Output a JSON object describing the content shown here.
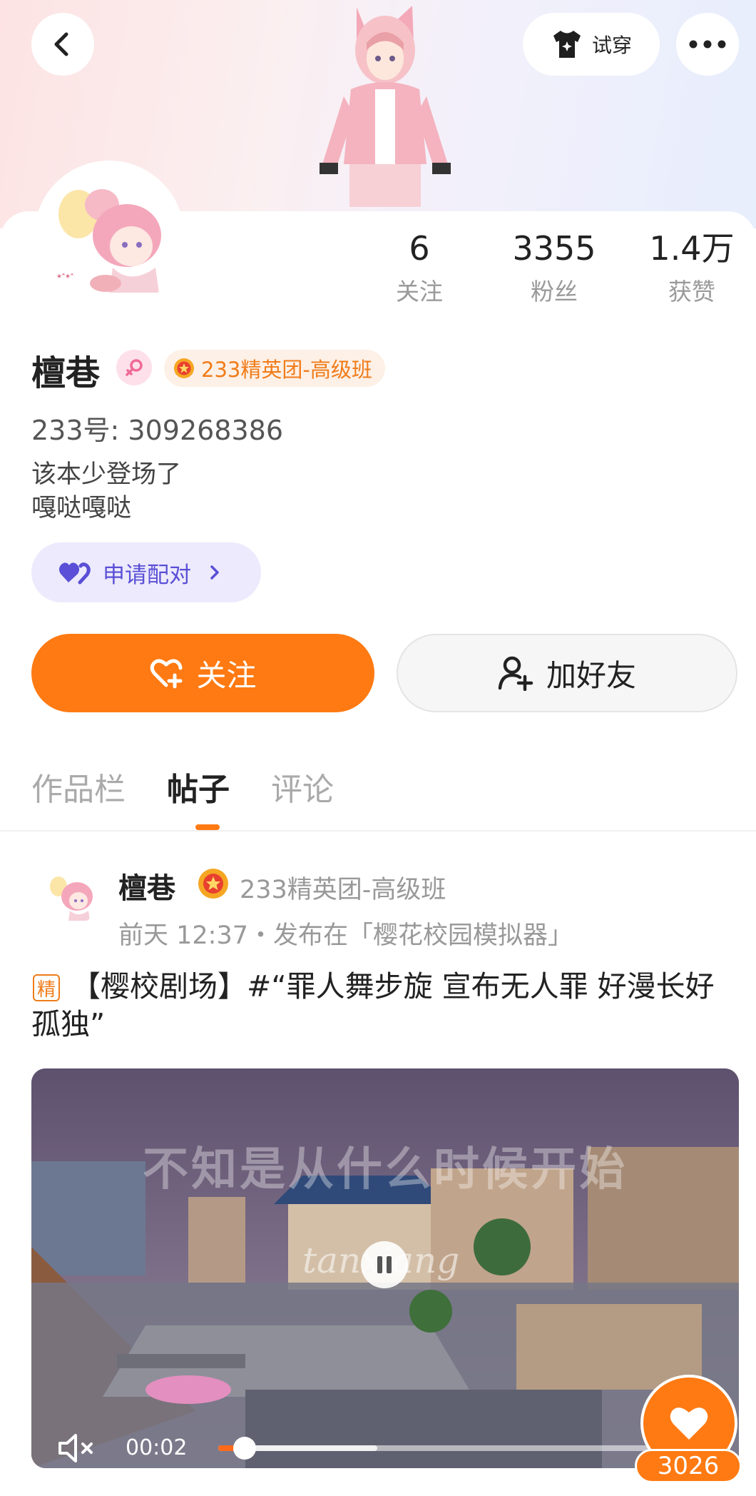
{
  "header": {
    "back_icon": "chevron-left-icon",
    "tryon_label": "试穿",
    "more_icon": "more-dots-icon"
  },
  "profile": {
    "username": "檀巷",
    "gender_icon": "female-icon",
    "elite_group": "233精英团-高级班",
    "uid": "233号: 309268386",
    "bio_line1": "该本少登场了",
    "bio_line2": "嘎哒嘎哒",
    "pair_label": "申请配对",
    "stats": [
      {
        "value": "6",
        "label": "关注"
      },
      {
        "value": "3355",
        "label": "粉丝"
      },
      {
        "value": "1.4万",
        "label": "获赞"
      }
    ]
  },
  "actions": {
    "follow_label": "关注",
    "add_friend_label": "加好友"
  },
  "tabs": [
    {
      "label": "作品栏",
      "active": false
    },
    {
      "label": "帖子",
      "active": true
    },
    {
      "label": "评论",
      "active": false
    }
  ],
  "post": {
    "user": "檀巷",
    "group": "233精英团-高级班",
    "meta": "前天 12:37・发布在「樱花校园模拟器」",
    "tag": "精",
    "title": "【樱校剧场】#“罪人舞步旋 宣布无人罪 好漫长好孤独”",
    "video": {
      "subtitle": "不知是从什么时候开始",
      "watermark": "tanxiang",
      "time": "00:02",
      "progress": 0.06,
      "buffered": 0.36,
      "mute_icon": "speaker-muted-icon"
    },
    "likes": "3026"
  },
  "colors": {
    "accent": "#ff7a12",
    "pair": "#5a4fd6",
    "elite": "#f07c1a"
  }
}
